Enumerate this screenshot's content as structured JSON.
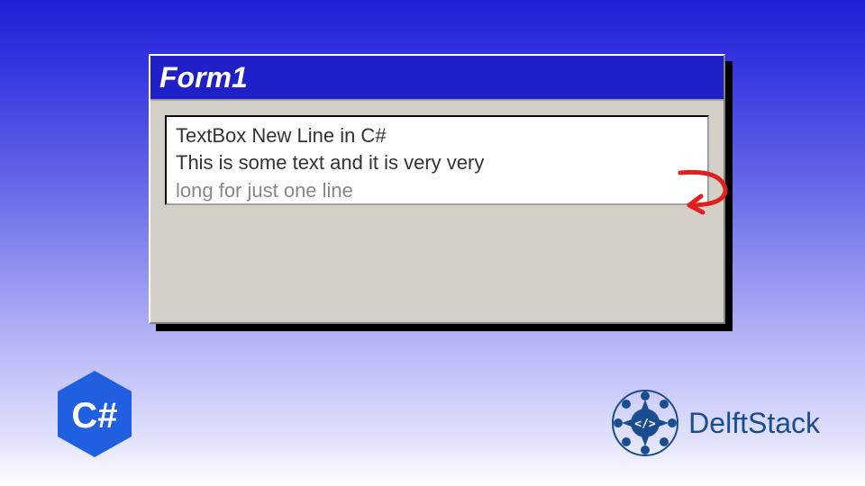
{
  "window": {
    "title": "Form1",
    "textbox": {
      "line1": "TextBox New Line in C#",
      "line2": "This is some text and it is very very",
      "line3": "long for just one line"
    }
  },
  "logos": {
    "csharp_label": "C#",
    "delftstack_label": "DelftStack"
  },
  "colors": {
    "titlebar_bg": "#2020c8",
    "window_bg": "#d4d0c8",
    "arrow": "#e02020",
    "csharp_bg": "#2060e0",
    "delftstack_accent": "#1a4d8f"
  }
}
